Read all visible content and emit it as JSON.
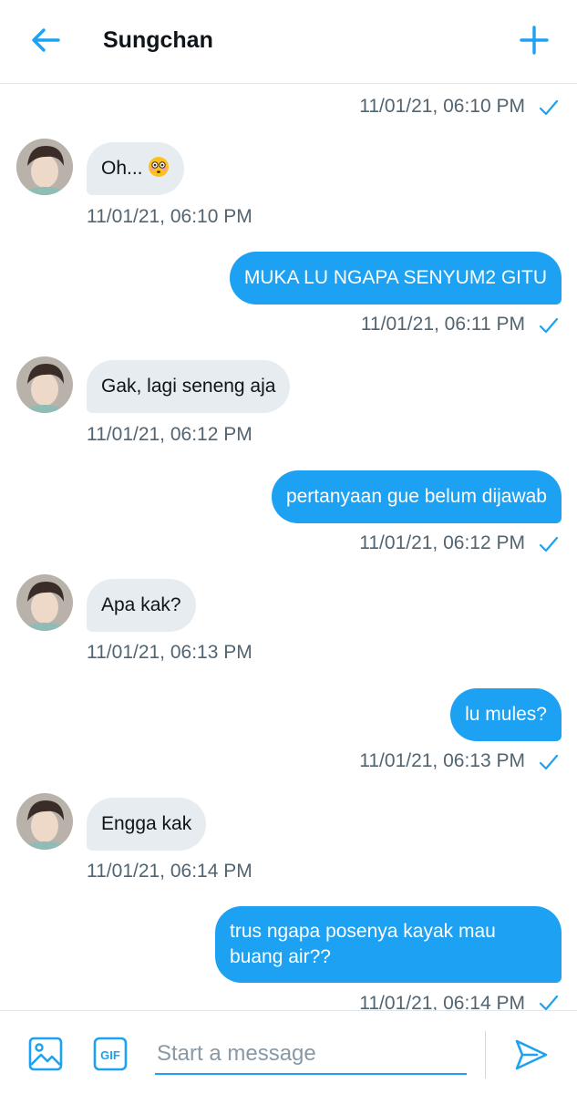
{
  "header": {
    "title": "Sungchan",
    "back_icon": "arrow-left-icon",
    "new_icon": "plus-icon"
  },
  "theme": {
    "accent": "#1da1f2",
    "incoming_bubble": "#e6ecf0",
    "timestamp": "#536471"
  },
  "messages": [
    {
      "direction": "out-timestamp-only",
      "timestamp": "11/01/21, 06:10 PM",
      "read": true
    },
    {
      "direction": "in",
      "text": "Oh... ",
      "emoji": "flushed-face-emoji",
      "timestamp": "11/01/21, 06:10 PM"
    },
    {
      "direction": "out",
      "text": "MUKA LU NGAPA SENYUM2 GITU",
      "timestamp": "11/01/21, 06:11 PM",
      "read": true
    },
    {
      "direction": "in",
      "text": "Gak, lagi seneng aja",
      "timestamp": "11/01/21, 06:12 PM"
    },
    {
      "direction": "out",
      "text": "pertanyaan gue belum dijawab",
      "timestamp": "11/01/21, 06:12 PM",
      "read": true
    },
    {
      "direction": "in",
      "text": "Apa kak?",
      "timestamp": "11/01/21, 06:13 PM"
    },
    {
      "direction": "out",
      "text": "lu mules?",
      "timestamp": "11/01/21, 06:13 PM",
      "read": true
    },
    {
      "direction": "in",
      "text": "Engga kak",
      "timestamp": "11/01/21, 06:14 PM"
    },
    {
      "direction": "out",
      "text": "trus ngapa posenya kayak mau buang air??",
      "timestamp": "11/01/21, 06:14 PM",
      "read": true
    }
  ],
  "composer": {
    "placeholder": "Start a message",
    "media_icon": "image-icon",
    "gif_label": "GIF",
    "send_icon": "send-icon"
  }
}
